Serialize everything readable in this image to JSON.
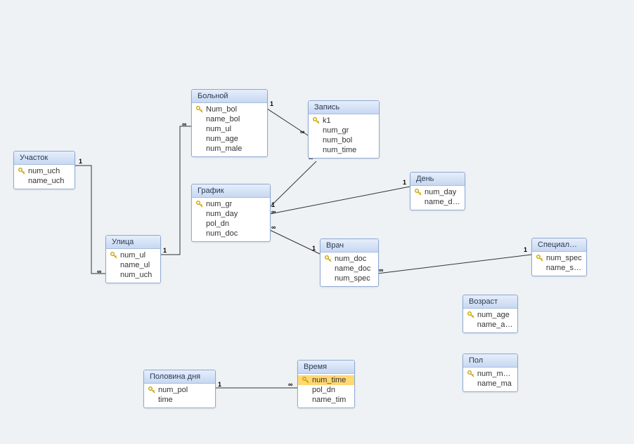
{
  "entities": {
    "uchastok": {
      "title": "Участок",
      "fields": [
        {
          "name": "num_uch",
          "key": true
        },
        {
          "name": "name_uch",
          "key": false
        }
      ]
    },
    "ulitsa": {
      "title": "Улица",
      "fields": [
        {
          "name": "num_ul",
          "key": true
        },
        {
          "name": "name_ul",
          "key": false
        },
        {
          "name": "num_uch",
          "key": false
        }
      ]
    },
    "bolnoy": {
      "title": "Больной",
      "fields": [
        {
          "name": "Num_bol",
          "key": true
        },
        {
          "name": "name_bol",
          "key": false
        },
        {
          "name": "num_ul",
          "key": false
        },
        {
          "name": "num_age",
          "key": false
        },
        {
          "name": "num_male",
          "key": false
        }
      ]
    },
    "zapis": {
      "title": "Запись",
      "fields": [
        {
          "name": "k1",
          "key": true
        },
        {
          "name": "num_gr",
          "key": false
        },
        {
          "name": "num_bol",
          "key": false
        },
        {
          "name": "num_time",
          "key": false
        }
      ]
    },
    "grafik": {
      "title": "График",
      "fields": [
        {
          "name": "num_gr",
          "key": true
        },
        {
          "name": "num_day",
          "key": false
        },
        {
          "name": "pol_dn",
          "key": false
        },
        {
          "name": "num_doc",
          "key": false
        }
      ]
    },
    "den": {
      "title": "День",
      "fields": [
        {
          "name": "num_day",
          "key": true
        },
        {
          "name": "name_day",
          "key": false
        }
      ]
    },
    "vrach": {
      "title": "Врач",
      "fields": [
        {
          "name": "num_doc",
          "key": true
        },
        {
          "name": "name_doc",
          "key": false
        },
        {
          "name": "num_spec",
          "key": false
        }
      ]
    },
    "special": {
      "title": "Специальн...",
      "fields": [
        {
          "name": "num_spec",
          "key": true
        },
        {
          "name": "name_spe",
          "key": false
        }
      ]
    },
    "vozrast": {
      "title": "Возраст",
      "fields": [
        {
          "name": "num_age",
          "key": true
        },
        {
          "name": "name_age",
          "key": false
        }
      ]
    },
    "pol": {
      "title": "Пол",
      "fields": [
        {
          "name": "num_male",
          "key": true
        },
        {
          "name": "name_ma",
          "key": false
        }
      ]
    },
    "polovina": {
      "title": "Половина дня",
      "fields": [
        {
          "name": "num_pol",
          "key": true
        },
        {
          "name": "time",
          "key": false
        }
      ]
    },
    "vremya": {
      "title": "Время",
      "fields": [
        {
          "name": "num_time",
          "key": true,
          "selected": true
        },
        {
          "name": "pol_dn",
          "key": false
        },
        {
          "name": "name_tim",
          "key": false
        }
      ]
    }
  },
  "labels": {
    "one": "1",
    "many": "∞"
  }
}
